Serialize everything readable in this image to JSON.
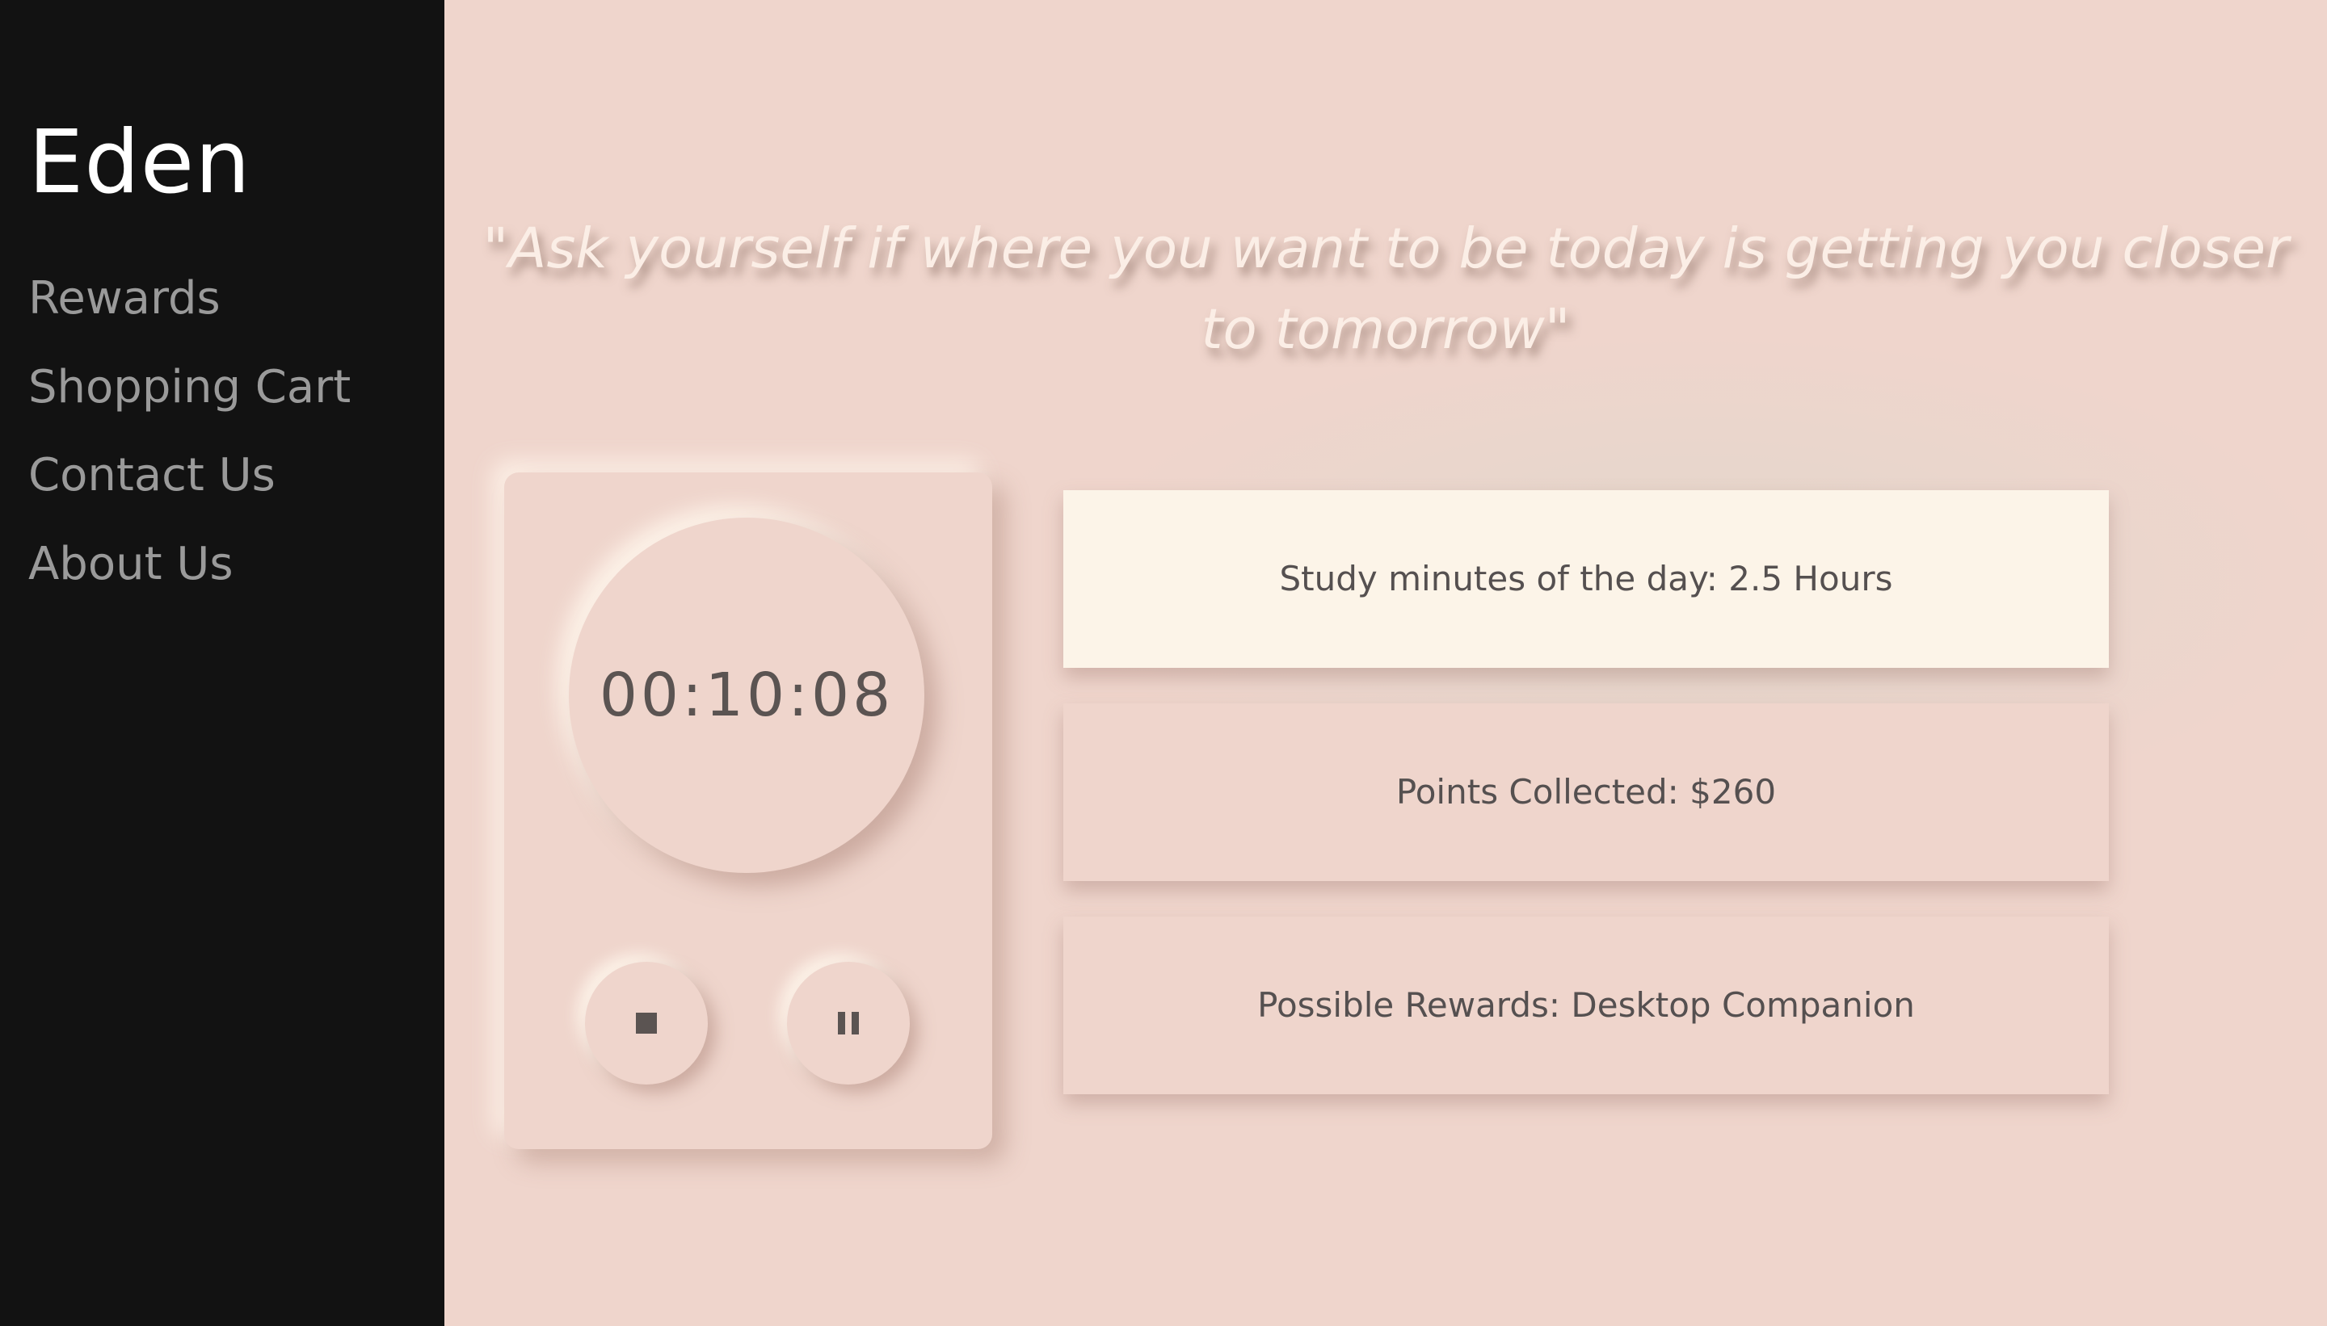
{
  "sidebar": {
    "brand": "Eden",
    "nav": [
      {
        "label": "Rewards"
      },
      {
        "label": "Shopping Cart"
      },
      {
        "label": "Contact Us"
      },
      {
        "label": "About Us"
      }
    ]
  },
  "main": {
    "quote": "\"Ask yourself if where you want to be today is getting you closer to tomorrow\"",
    "timer": {
      "display": "00:10:08",
      "stop_icon": "stop-icon",
      "pause_icon": "pause-icon"
    },
    "stats": [
      {
        "text": "Study minutes of the day: 2.5 Hours"
      },
      {
        "text": "Points Collected: $260"
      },
      {
        "text": "Possible Rewards: Desktop Companion"
      }
    ]
  },
  "colors": {
    "sidebar_bg": "#121212",
    "page_bg": "#efd5cc",
    "highlight_card": "#fcf4e8",
    "text_dark": "#5b5452",
    "nav_text": "#9a9a9a"
  }
}
